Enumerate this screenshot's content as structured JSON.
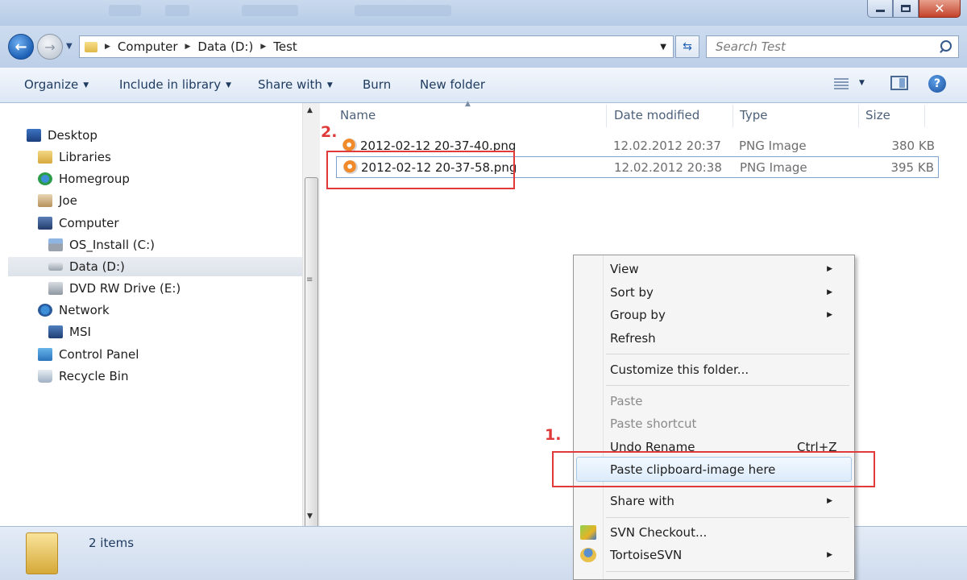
{
  "address": {
    "crumbs": [
      "Computer",
      "Data (D:)",
      "Test"
    ],
    "search_placeholder": "Search Test"
  },
  "toolbar": {
    "organize": "Organize",
    "include": "Include in library",
    "share": "Share with",
    "burn": "Burn",
    "new_folder": "New folder"
  },
  "nav": {
    "items": [
      {
        "label": "Desktop",
        "icon": "desktop-icon"
      },
      {
        "label": "Libraries",
        "icon": "libraries-icon"
      },
      {
        "label": "Homegroup",
        "icon": "homegroup-icon"
      },
      {
        "label": "Joe",
        "icon": "user-icon"
      },
      {
        "label": "Computer",
        "icon": "computer-icon"
      },
      {
        "label": "OS_Install (C:)",
        "icon": "drive-icon"
      },
      {
        "label": "Data (D:)",
        "icon": "drive-icon",
        "selected": true
      },
      {
        "label": "DVD RW Drive (E:)",
        "icon": "dvd-drive-icon"
      },
      {
        "label": "Network",
        "icon": "network-icon"
      },
      {
        "label": "MSI",
        "icon": "network-computer-icon"
      },
      {
        "label": "Control Panel",
        "icon": "control-panel-icon"
      },
      {
        "label": "Recycle Bin",
        "icon": "recycle-bin-icon"
      }
    ]
  },
  "files": {
    "columns": [
      "Name",
      "Date modified",
      "Type",
      "Size"
    ],
    "rows": [
      {
        "name": "2012-02-12 20-37-40.png",
        "date": "12.02.2012 20:37",
        "type": "PNG Image",
        "size": "380 KB"
      },
      {
        "name": "2012-02-12 20-37-58.png",
        "date": "12.02.2012 20:38",
        "type": "PNG Image",
        "size": "395 KB",
        "selected": true
      }
    ]
  },
  "status": {
    "count": "2 items"
  },
  "context_menu": {
    "view": "View",
    "sort_by": "Sort by",
    "group_by": "Group by",
    "refresh": "Refresh",
    "customize": "Customize this folder...",
    "paste": "Paste",
    "paste_shortcut": "Paste shortcut",
    "undo_rename": "Undo Rename",
    "undo_shortcut": "Ctrl+Z",
    "paste_clipboard": "Paste clipboard-image here",
    "share_with": "Share with",
    "svn_checkout": "SVN Checkout...",
    "tortoise": "TortoiseSVN"
  },
  "annotations": {
    "step1": "1.",
    "step2": "2."
  },
  "colors": {
    "annotation": "#e03a3a",
    "accent": "#1d5fb4"
  }
}
